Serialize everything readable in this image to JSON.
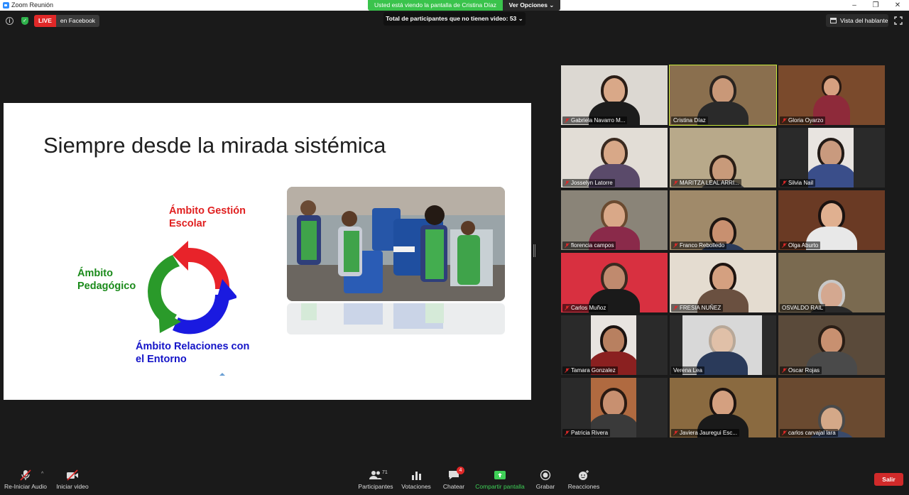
{
  "window": {
    "title": "Zoom Reunión",
    "minimize_glyph": "–",
    "restore_glyph": "❐",
    "close_glyph": "✕"
  },
  "share_banner": {
    "text": "Usted está viendo la pantalla de Cristina Díaz",
    "options_label": "Ver Opciones ⌄"
  },
  "top_bar": {
    "info_glyph": "i",
    "shield_glyph": "✓",
    "live_label": "LIVE",
    "live_platform": "en Facebook",
    "notice": "Total de participantes que no tienen video: 53  ⌄",
    "speaker_view_label": "Vista del hablante"
  },
  "slide": {
    "title": "Siempre desde la mirada sistémica",
    "label_gestion": [
      "Ámbito Gestión",
      "Escolar"
    ],
    "label_pedagogico": [
      "Ámbito",
      "Pedagógico"
    ],
    "label_relaciones": [
      "Ámbito Relaciones con",
      "el Entorno"
    ],
    "colors": {
      "red": "#e8232a",
      "green": "#2a9a2a",
      "blue": "#1a1ae0"
    }
  },
  "participants": [
    {
      "name": "Gabriela Navarro M...",
      "muted": true,
      "active": false
    },
    {
      "name": "Cristina Díaz",
      "muted": false,
      "active": true
    },
    {
      "name": "Gloria Oyarzo",
      "muted": true,
      "active": false
    },
    {
      "name": "Josselyn Latorre",
      "muted": true,
      "active": false
    },
    {
      "name": "MARITZA LEAL ARRI...",
      "muted": true,
      "active": false
    },
    {
      "name": "Silvia Nail",
      "muted": true,
      "active": false
    },
    {
      "name": "florencia campos",
      "muted": true,
      "active": false
    },
    {
      "name": "Franco Rebolledo",
      "muted": true,
      "active": false
    },
    {
      "name": "Olga Aburto",
      "muted": true,
      "active": false
    },
    {
      "name": "Carlos Muñoz",
      "muted": true,
      "active": false
    },
    {
      "name": "FRESIA NUÑEZ",
      "muted": true,
      "active": false
    },
    {
      "name": "OSVALDO RAIL",
      "muted": false,
      "active": false
    },
    {
      "name": "Tamara Gonzalez",
      "muted": true,
      "active": false
    },
    {
      "name": "Verena Lea",
      "muted": false,
      "active": false
    },
    {
      "name": "Oscar Rojas",
      "muted": true,
      "active": false
    },
    {
      "name": "Patricia Rivera",
      "muted": true,
      "active": false
    },
    {
      "name": "Javiera Jauregui Esc...",
      "muted": true,
      "active": false
    },
    {
      "name": "carlos carvajal lara",
      "muted": true,
      "active": false
    }
  ],
  "toolbar": {
    "audio_label": "Re-Iniciar Audio",
    "audio_caret": "^",
    "video_label": "Iniciar video",
    "participants_label": "Participantes",
    "participants_count": "71",
    "polls_label": "Votaciones",
    "chat_label": "Chatear",
    "chat_badge": "4",
    "share_label": "Compartir pantalla",
    "record_label": "Grabar",
    "reactions_label": "Reacciones",
    "leave_label": "Salir"
  },
  "colors": {
    "share_green": "#3ac34c",
    "live_red": "#e02828",
    "active_speaker": "#c8e83a",
    "leave_red": "#d12a2a"
  }
}
